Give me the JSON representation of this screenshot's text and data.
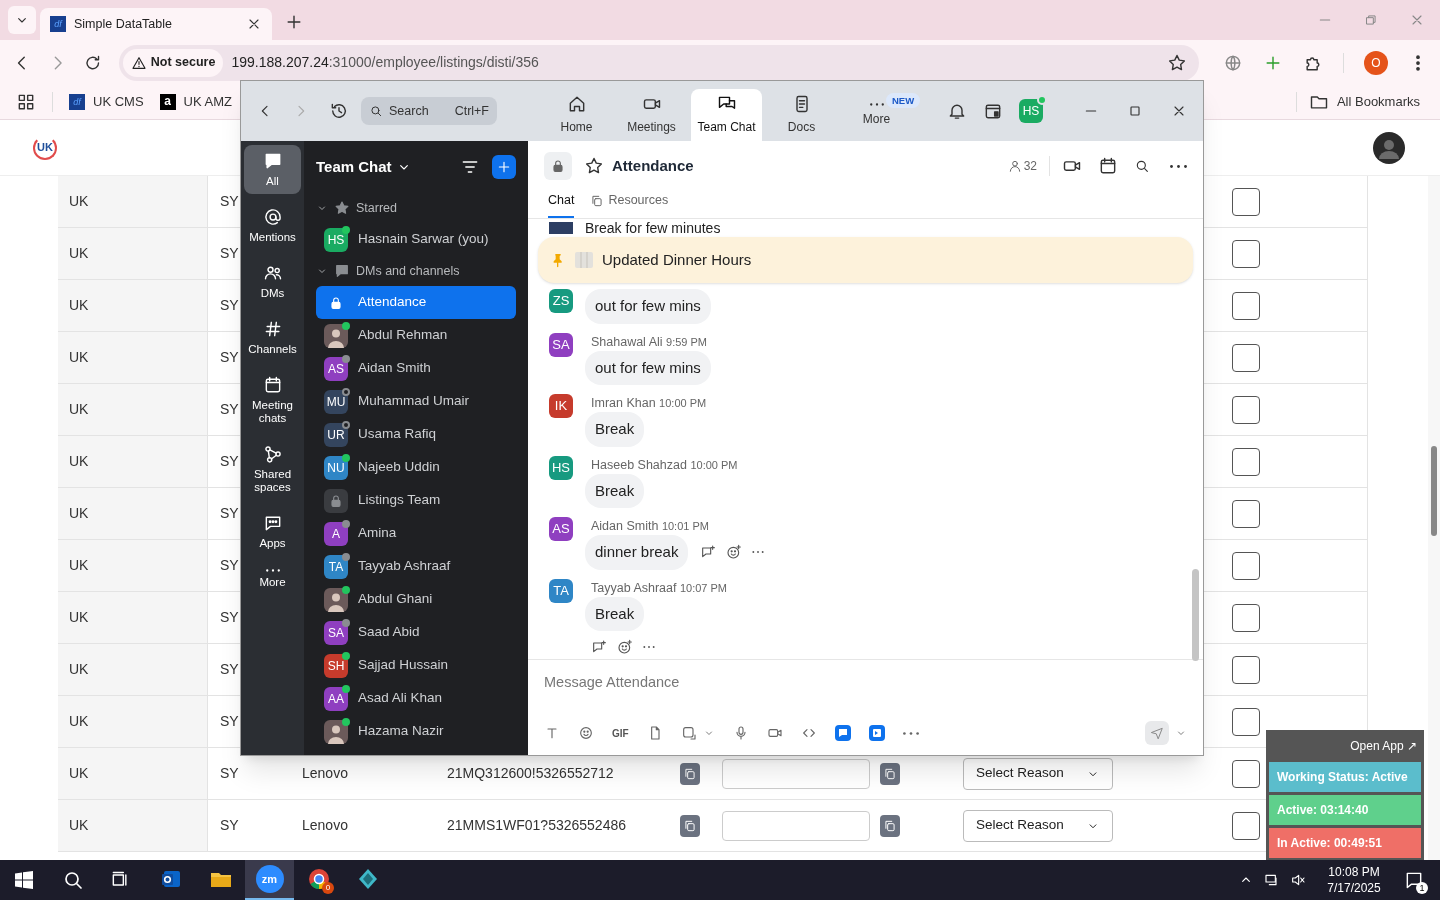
{
  "browser": {
    "tabs": [
      {
        "title": "Simple DataTable",
        "favicon": "df",
        "selected": true
      }
    ],
    "address": {
      "security": "Not secure",
      "host": "199.188.207.24",
      "path": ":31000/employee/listings/disti/356"
    },
    "profile": "O",
    "bookmarks": [
      {
        "label": "UK CMS",
        "kind": "df",
        "icon_text": "df"
      },
      {
        "label": "UK AMZ",
        "kind": "amazon",
        "icon_text": "a"
      }
    ],
    "all_bookmarks": "All Bookmarks"
  },
  "page": {
    "logo": "UK",
    "rows": [
      {
        "country": "UK",
        "code": "SY",
        "checked": false
      },
      {
        "country": "UK",
        "code": "SY",
        "checked": false
      },
      {
        "country": "UK",
        "code": "SY",
        "checked": false
      },
      {
        "country": "UK",
        "code": "SY",
        "checked": false
      },
      {
        "country": "UK",
        "code": "SY",
        "checked": false
      },
      {
        "country": "UK",
        "code": "SY",
        "checked": false
      },
      {
        "country": "UK",
        "code": "SY",
        "checked": false
      },
      {
        "country": "UK",
        "code": "SY",
        "checked": false
      },
      {
        "country": "UK",
        "code": "SY",
        "checked": false
      },
      {
        "country": "UK",
        "code": "SY",
        "checked": false
      },
      {
        "country": "UK",
        "code": "SY",
        "checked": false
      },
      {
        "country": "UK",
        "code": "SY",
        "brand": "Lenovo",
        "serial": "21MQ312600!5326552712",
        "reason": "Select Reason",
        "checked": false
      },
      {
        "country": "UK",
        "code": "SY",
        "brand": "Lenovo",
        "serial": "21MMS1WF01?5326552486",
        "reason": "Select Reason",
        "checked": false
      }
    ],
    "tracker": {
      "open_app": "Open App ↗",
      "working_status": "Working Status: Active",
      "active": "Active: 03:14:40",
      "inactive": "In Active: 00:49:51"
    }
  },
  "zoom": {
    "search": {
      "placeholder": "Search",
      "shortcut": "Ctrl+F"
    },
    "nav": [
      {
        "label": "Home",
        "selected": false
      },
      {
        "label": "Meetings",
        "selected": false
      },
      {
        "label": "Team Chat",
        "selected": true
      },
      {
        "label": "Docs",
        "selected": false
      },
      {
        "label": "More",
        "selected": false,
        "badge": "NEW"
      }
    ],
    "user": {
      "initials": "HS",
      "color": "#1aab62",
      "online": true
    },
    "rail": [
      {
        "label": "All",
        "selected": true
      },
      {
        "label": "Mentions",
        "selected": false
      },
      {
        "label": "DMs",
        "selected": false
      },
      {
        "label": "Channels",
        "selected": false
      },
      {
        "label": "Meeting chats",
        "selected": false
      },
      {
        "label": "Shared spaces",
        "selected": false
      },
      {
        "label": "Apps",
        "selected": false
      },
      {
        "label": "More",
        "selected": false
      }
    ],
    "chat_list": {
      "title": "Team Chat",
      "sections": [
        {
          "label": "Starred",
          "expanded": true,
          "items": [
            {
              "name": "Hasnain Sarwar (you)",
              "kind": "initials",
              "initials": "HS",
              "color": "#1aab62",
              "online": true,
              "selected": false
            }
          ]
        },
        {
          "label": "DMs and channels",
          "expanded": true,
          "items": [
            {
              "name": "Attendance",
              "kind": "channel",
              "selected": true
            },
            {
              "name": "Abdul Rehman",
              "kind": "photo",
              "online": true,
              "selected": false
            },
            {
              "name": "Aidan Smith",
              "kind": "initials",
              "initials": "AS",
              "color": "#8f3fc0",
              "online": false,
              "away": true,
              "selected": false
            },
            {
              "name": "Muhammad Umair",
              "kind": "initials",
              "initials": "MU",
              "color": "#34455e",
              "online": false,
              "away": false,
              "selected": false
            },
            {
              "name": "Usama Rafiq",
              "kind": "initials",
              "initials": "UR",
              "color": "#34455e",
              "online": false,
              "away": false,
              "selected": false
            },
            {
              "name": "Najeeb Uddin",
              "kind": "initials",
              "initials": "NU",
              "color": "#2f86c6",
              "online": true,
              "selected": false
            },
            {
              "name": "Listings Team",
              "kind": "channel",
              "selected": false
            },
            {
              "name": "Amina",
              "kind": "initials",
              "initials": "A",
              "color": "#8f3fc0",
              "online": false,
              "away": true,
              "selected": false
            },
            {
              "name": "Tayyab Ashraaf",
              "kind": "initials",
              "initials": "TA",
              "color": "#2f86c6",
              "online": false,
              "away": true,
              "selected": false
            },
            {
              "name": "Abdul Ghani",
              "kind": "photo",
              "online": true,
              "selected": false
            },
            {
              "name": "Saad Abid",
              "kind": "initials",
              "initials": "SA",
              "color": "#8f3fc0",
              "online": false,
              "away": true,
              "selected": false
            },
            {
              "name": "Sajjad Hussain",
              "kind": "initials",
              "initials": "SH",
              "color": "#c63b2c",
              "online": true,
              "selected": false
            },
            {
              "name": "Asad Ali Khan",
              "kind": "initials",
              "initials": "AA",
              "color": "#8f3fc0",
              "online": true,
              "selected": false
            },
            {
              "name": "Hazama Nazir",
              "kind": "photo",
              "online": true,
              "selected": false
            }
          ]
        }
      ]
    },
    "channel": {
      "name": "Attendance",
      "members": "32",
      "tabs": [
        {
          "label": "Chat",
          "selected": true
        },
        {
          "label": "Resources",
          "selected": false
        }
      ],
      "pinned": "Updated Dinner Hours",
      "messages": [
        {
          "kind": "partial",
          "text": "Break for few minutes"
        },
        {
          "kind": "message",
          "initials": "ZS",
          "color": "#179a80",
          "text": "out for few mins"
        },
        {
          "kind": "message",
          "sender": "Shahawal Ali",
          "time": "9:59 PM",
          "initials": "SA",
          "color": "#8f3fc0",
          "text": "out for few mins"
        },
        {
          "kind": "message",
          "sender": "Imran Khan",
          "time": "10:00 PM",
          "initials": "IK",
          "color": "#c63b2c",
          "text": "Break"
        },
        {
          "kind": "message",
          "sender": "Haseeb Shahzad",
          "time": "10:00 PM",
          "initials": "HS",
          "color": "#179a80",
          "text": "Break"
        },
        {
          "kind": "message",
          "sender": "Aidan Smith",
          "time": "10:01 PM",
          "initials": "AS",
          "color": "#8f3fc0",
          "text": "dinner break",
          "hovered": true
        },
        {
          "kind": "message",
          "sender": "Tayyab Ashraaf",
          "time": "10:07 PM",
          "initials": "TA",
          "color": "#2f86c6",
          "text": "Break",
          "last": true
        }
      ],
      "composer": {
        "placeholder": "Message Attendance",
        "gif": "GIF"
      }
    }
  },
  "taskbar": {
    "apps": [
      {
        "kind": "outlook",
        "active": false
      },
      {
        "kind": "explorer",
        "active": false
      },
      {
        "kind": "zoom",
        "active": true,
        "text": "zm"
      },
      {
        "kind": "chrome",
        "active": false,
        "badge": "0"
      },
      {
        "kind": "other",
        "active": false
      }
    ],
    "time": "10:08 PM",
    "date": "7/17/2025",
    "notifications": "1"
  }
}
